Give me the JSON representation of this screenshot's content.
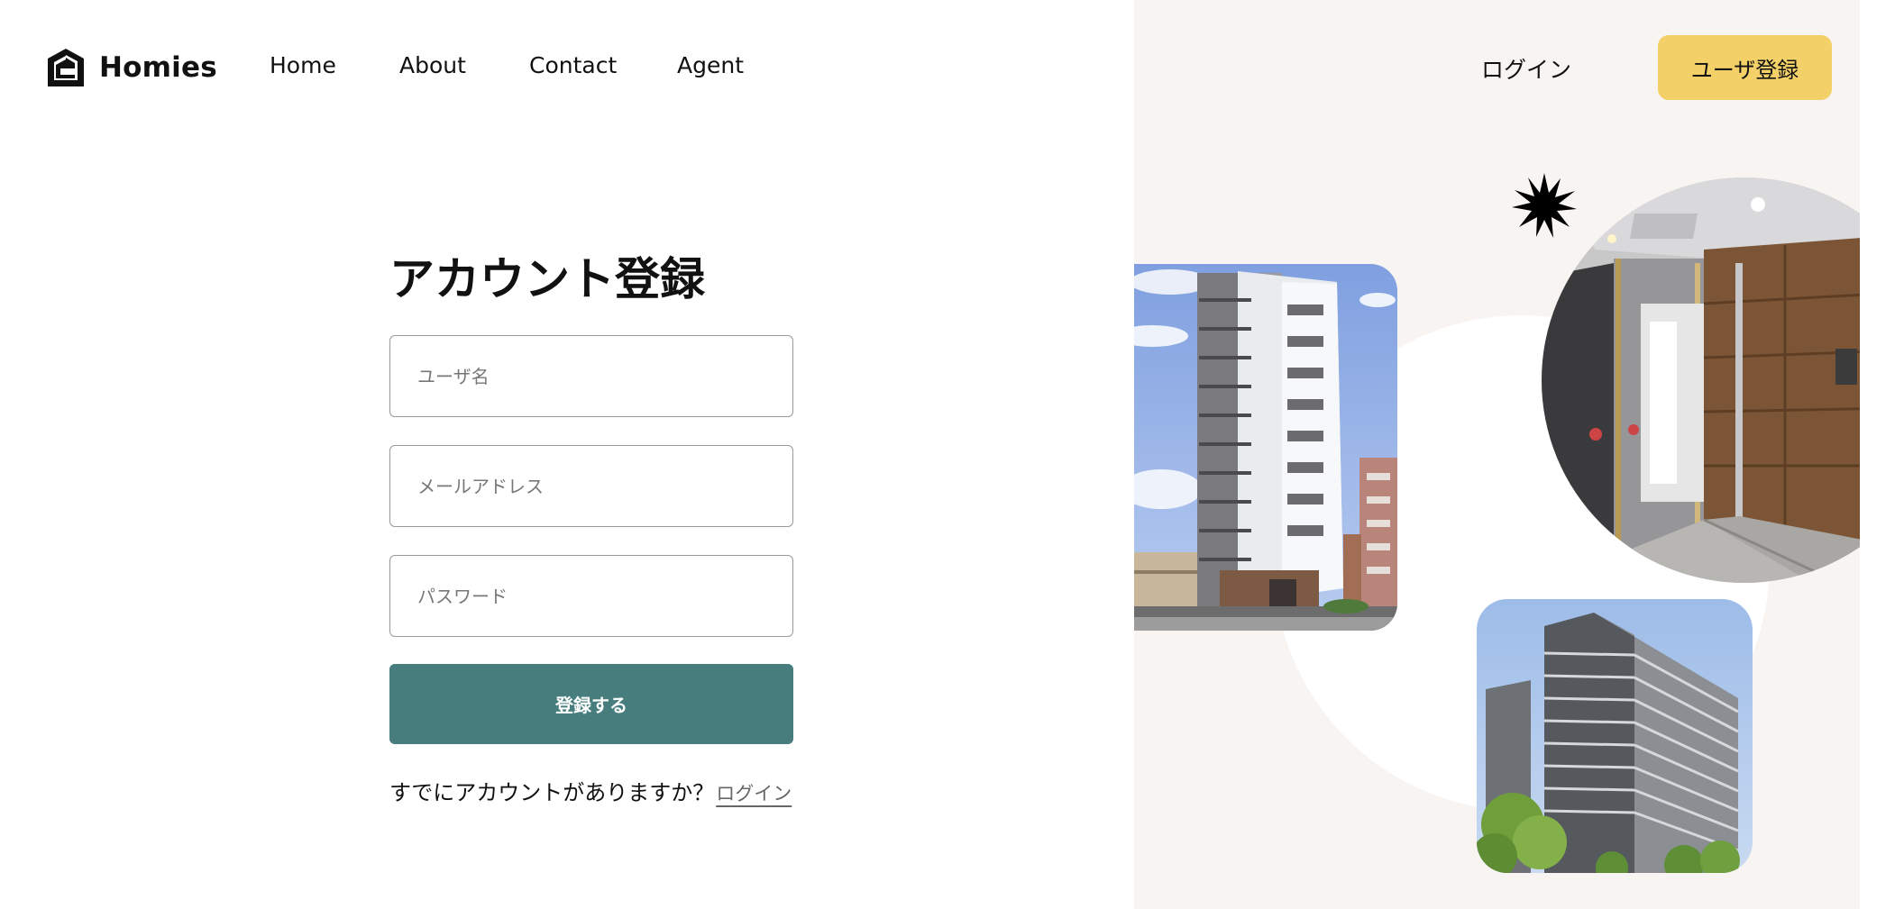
{
  "brand": {
    "name": "Homies",
    "logo_icon": "house-logo-icon"
  },
  "nav": {
    "items": [
      "Home",
      "About",
      "Contact",
      "Agent"
    ]
  },
  "header": {
    "login_label": "ログイン",
    "register_label": "ユーザ登録"
  },
  "form": {
    "title": "アカウント登録",
    "username_placeholder": "ユーザ名",
    "email_placeholder": "メールアドレス",
    "password_placeholder": "パスワード",
    "submit_label": "登録する",
    "have_account_text": "すでにアカウントがありますか？",
    "login_link": "ログイン"
  },
  "colors": {
    "accent_yellow": "#f3d168",
    "submit_teal": "#487d7d",
    "panel_bg": "#f8f4f2",
    "grid_circle": "#e3e2de"
  },
  "decor": {
    "star_icon": "starburst-icon",
    "photos": [
      "apartment-building-photo",
      "entrance-hall-photo",
      "residential-complex-photo"
    ]
  }
}
